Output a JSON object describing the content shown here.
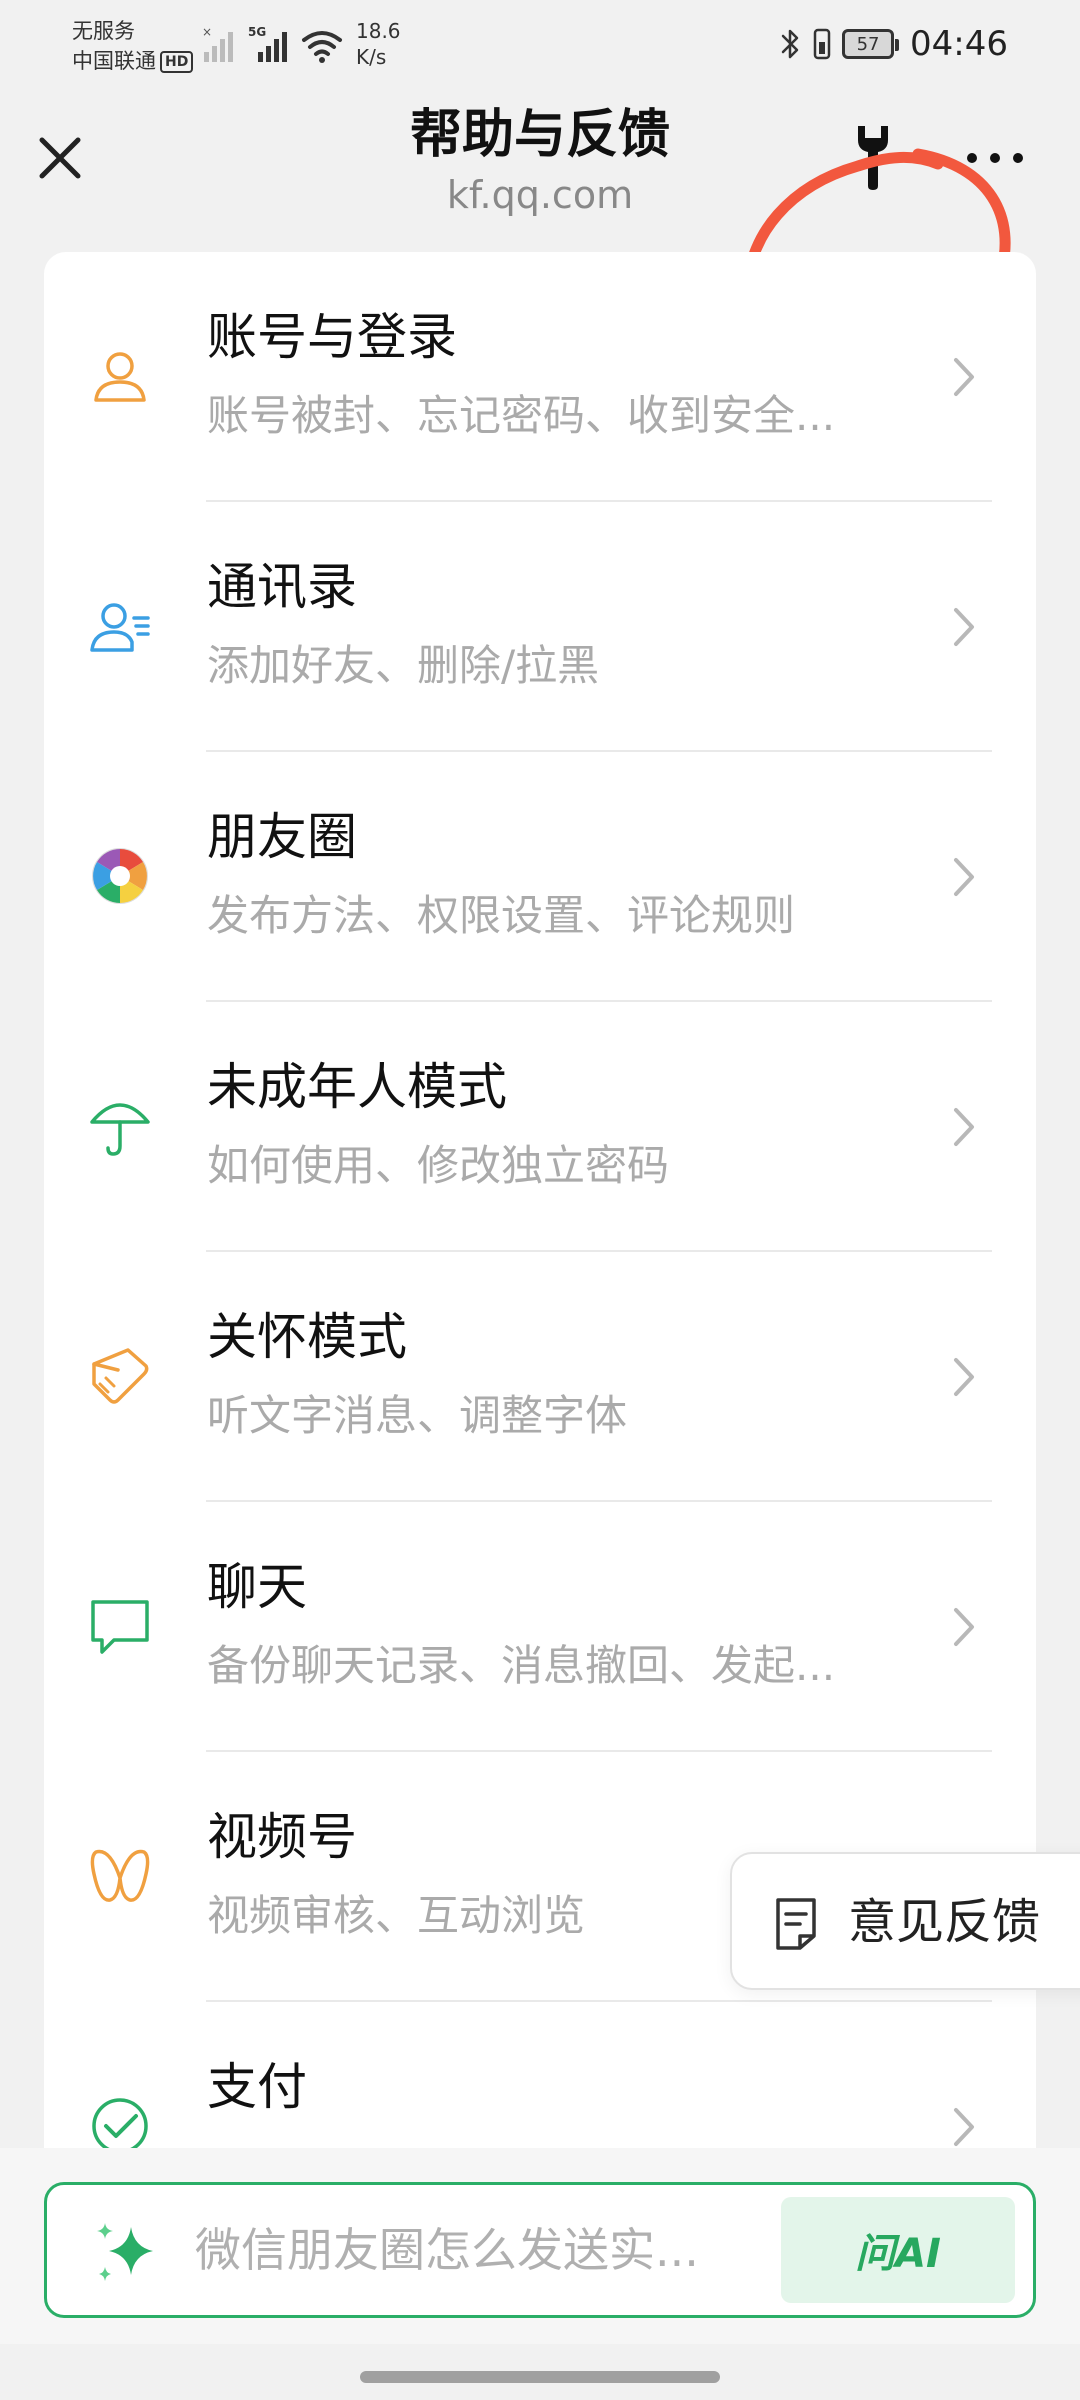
{
  "status_bar": {
    "carrier_line1": "无服务",
    "carrier_line2": "中国联通",
    "hd_badge": "HD",
    "network_type": "5G",
    "speed_value": "18.6",
    "speed_unit": "K/s",
    "battery_level": "57",
    "time": "04:46"
  },
  "header": {
    "title": "帮助与反馈",
    "subtitle": "kf.qq.com",
    "close_icon": "close-icon",
    "tool_icon": "wrench-icon",
    "more_icon": "more-dots-icon",
    "annotation_color": "#f2583e"
  },
  "list": {
    "items": [
      {
        "title": "账号与登录",
        "subtitle": "账号被封、忘记密码、收到安全...",
        "icon": "user-icon",
        "color": "#f0a040"
      },
      {
        "title": "通讯录",
        "subtitle": "添加好友、删除/拉黑",
        "icon": "contacts-icon",
        "color": "#3b9fe3"
      },
      {
        "title": "朋友圈",
        "subtitle": "发布方法、权限设置、评论规则",
        "icon": "moments-icon",
        "color": "#e84c3d"
      },
      {
        "title": "未成年人模式",
        "subtitle": "如何使用、修改独立密码",
        "icon": "umbrella-icon",
        "color": "#2aae67"
      },
      {
        "title": "关怀模式",
        "subtitle": "听文字消息、调整字体",
        "icon": "care-hand-icon",
        "color": "#f0a040"
      },
      {
        "title": "聊天",
        "subtitle": "备份聊天记录、消息撤回、发起...",
        "icon": "chat-bubble-icon",
        "color": "#2aae67"
      },
      {
        "title": "视频号",
        "subtitle": "视频审核、互动浏览",
        "icon": "channels-icon",
        "color": "#f0a040"
      },
      {
        "title": "支付",
        "subtitle": "",
        "icon": "pay-icon",
        "color": "#2aae67"
      }
    ]
  },
  "feedback": {
    "label": "意见反馈",
    "icon": "document-icon"
  },
  "bottom": {
    "placeholder": "微信朋友圈怎么发送实...",
    "ask_label": "问AI",
    "accent": "#2aae67"
  }
}
